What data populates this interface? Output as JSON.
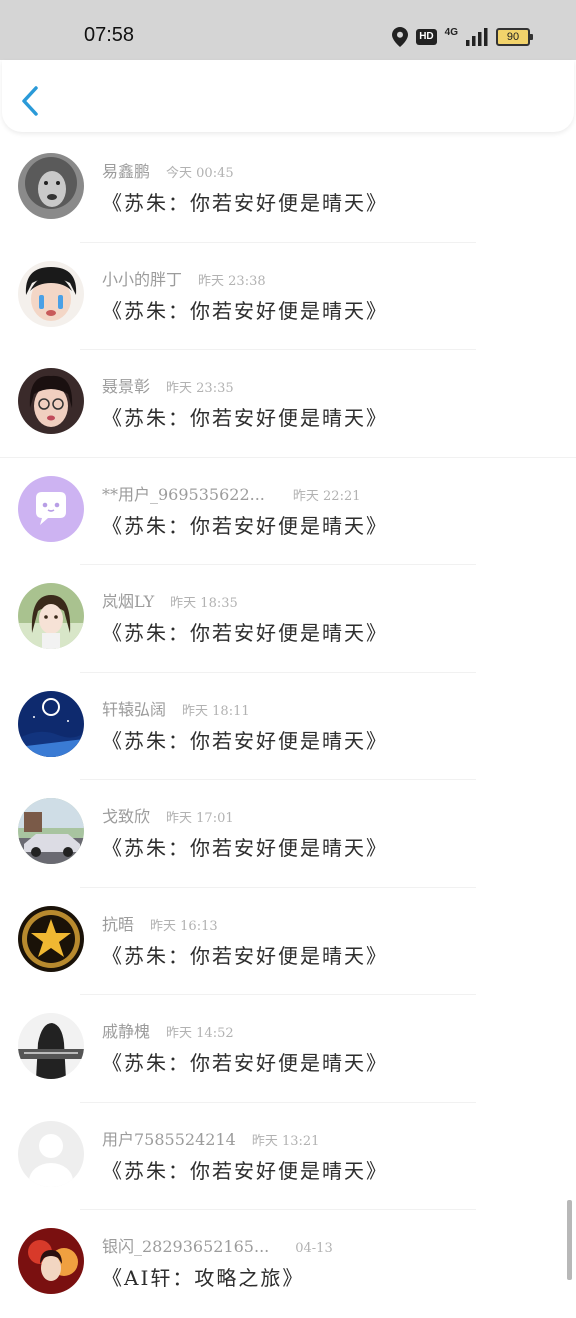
{
  "status_bar": {
    "time": "07:58",
    "hd": "HD",
    "network": "4G",
    "battery": "90"
  },
  "comments": [
    {
      "name": "易鑫鹏",
      "time": "今天 00:45",
      "text": "《苏朱：你若安好便是晴天》",
      "avatar": "lion-avatar"
    },
    {
      "name": "小小的胖丁",
      "time": "昨天 23:38",
      "text": "《苏朱：你若安好便是晴天》",
      "avatar": "crying-girl-avatar"
    },
    {
      "name": "聂景彰",
      "time": "昨天 23:35",
      "text": "《苏朱：你若安好便是晴天》",
      "avatar": "girl-glasses-avatar"
    },
    {
      "name": "**用户_969535622...",
      "time": "昨天 22:21",
      "text": "《苏朱：你若安好便是晴天》",
      "avatar": "default-chat-avatar"
    },
    {
      "name": "岚烟LY",
      "time": "昨天 18:35",
      "text": "《苏朱：你若安好便是晴天》",
      "avatar": "anime-girl-avatar"
    },
    {
      "name": "轩辕弘阔",
      "time": "昨天 18:11",
      "text": "《苏朱：你若安好便是晴天》",
      "avatar": "night-sky-avatar"
    },
    {
      "name": "戈致欣",
      "time": "昨天 17:01",
      "text": "《苏朱：你若安好便是晴天》",
      "avatar": "car-avatar"
    },
    {
      "name": "抗晤",
      "time": "昨天 16:13",
      "text": "《苏朱：你若安好便是晴天》",
      "avatar": "star-badge-avatar"
    },
    {
      "name": "戚静槐",
      "time": "昨天 14:52",
      "text": "《苏朱：你若安好便是晴天》",
      "avatar": "bw-photo-avatar"
    },
    {
      "name": "用户7585524214",
      "time": "昨天 13:21",
      "text": "《苏朱：你若安好便是晴天》",
      "avatar": "default-user-avatar"
    },
    {
      "name": "银闪_28293652165...",
      "time": "04-13",
      "text": "《AI轩：攻略之旅》",
      "avatar": "red-art-avatar"
    }
  ]
}
